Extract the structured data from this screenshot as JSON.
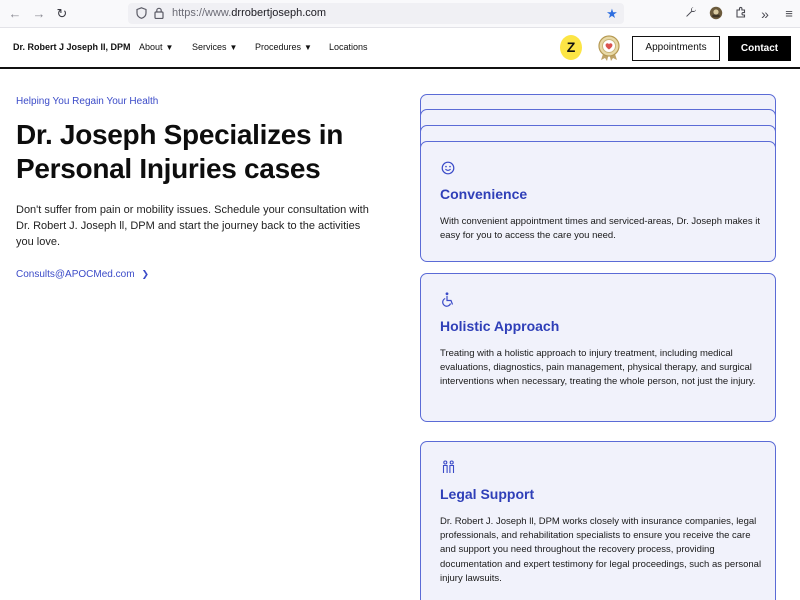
{
  "browser": {
    "url_prefix": "https://www.",
    "url_domain": "drrobertjoseph.com",
    "icons": [
      "back-arrow-icon",
      "forward-arrow-icon",
      "reload-icon",
      "shield-icon",
      "lock-icon",
      "bookmark-star-icon",
      "wrench-icon",
      "profile-icon",
      "extensions-icon",
      "overflow-icon",
      "menu-icon"
    ]
  },
  "header": {
    "brand": "Dr. Robert J Joseph II, DPM",
    "menu": [
      {
        "label": "About",
        "has_dropdown": true
      },
      {
        "label": "Services",
        "has_dropdown": true
      },
      {
        "label": "Procedures",
        "has_dropdown": true
      },
      {
        "label": "Locations",
        "has_dropdown": false
      }
    ],
    "zocdoc_letter": "Z",
    "appointments_label": "Appointments",
    "contact_label": "Contact"
  },
  "hero": {
    "eyebrow": "Helping You Regain Your Health",
    "title": "Dr. Joseph Specializes in Personal Injuries cases",
    "body": "Don't suffer from pain or mobility issues. Schedule your consultation with Dr. Robert J. Joseph ll, DPM and start the journey back to the activities you love.",
    "email": "Consults@APOCMed.com"
  },
  "cards": [
    {
      "icon": "smile-icon",
      "title": "Convenience",
      "text": "With convenient appointment times and serviced-areas, Dr. Joseph makes it easy for you to access the care you need."
    },
    {
      "icon": "wheelchair-icon",
      "title": "Holistic Approach",
      "text": "Treating with a holistic approach to injury treatment, including medical evaluations, diagnostics, pain management, physical therapy, and surgical interventions when necessary, treating the whole person, not just the injury."
    },
    {
      "icon": "people-icon",
      "title": "Legal Support",
      "text": "Dr. Robert J. Joseph ll, DPM works closely with insurance companies, legal professionals, and rehabilitation specialists to ensure you receive the care and support you need throughout the recovery process, providing documentation and expert testimony for legal proceedings, such as personal injury lawsuits."
    }
  ],
  "colors": {
    "accent": "#3b4bc8",
    "card_bg": "#f1f2fb",
    "card_border": "#5b6bd6",
    "zocdoc_yellow": "#fce545"
  }
}
